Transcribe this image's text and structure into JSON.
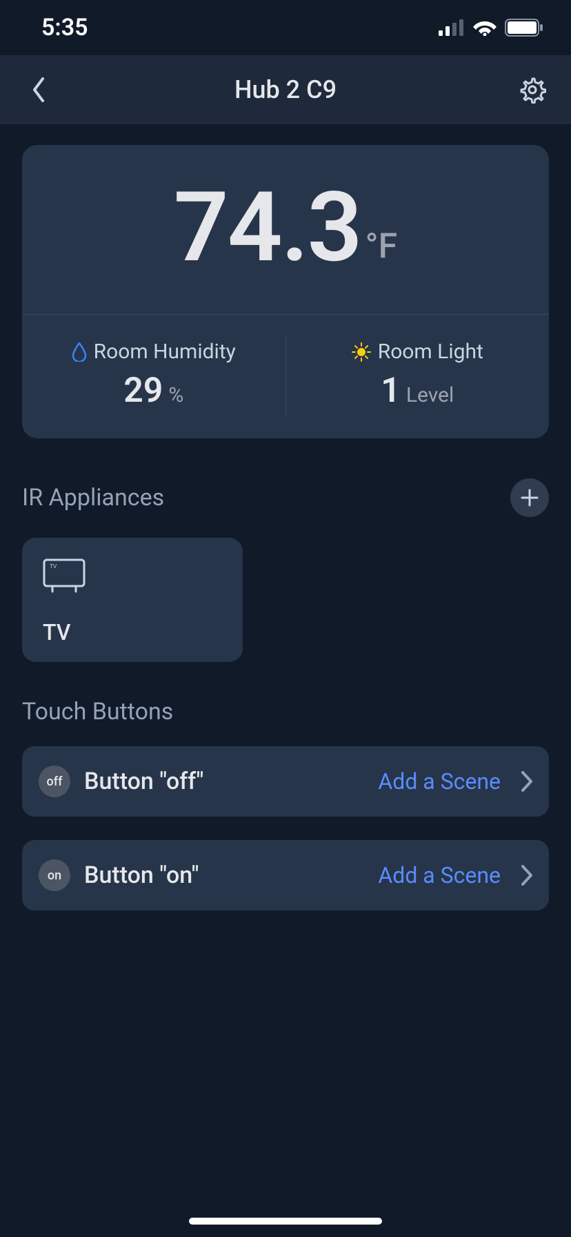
{
  "status": {
    "time": "5:35"
  },
  "nav": {
    "title": "Hub 2 C9"
  },
  "temperature": {
    "value": "74.3",
    "unit": "°F"
  },
  "humidity": {
    "label": "Room Humidity",
    "value": "29",
    "unit": "%"
  },
  "light": {
    "label": "Room Light",
    "value": "1",
    "unit": "Level"
  },
  "sections": {
    "ir": "IR Appliances",
    "touch": "Touch Buttons"
  },
  "appliances": [
    {
      "name": "TV"
    }
  ],
  "touch_buttons": [
    {
      "badge": "off",
      "label": "Button \"off\"",
      "action": "Add a Scene"
    },
    {
      "badge": "on",
      "label": "Button \"on\"",
      "action": "Add a Scene"
    }
  ]
}
